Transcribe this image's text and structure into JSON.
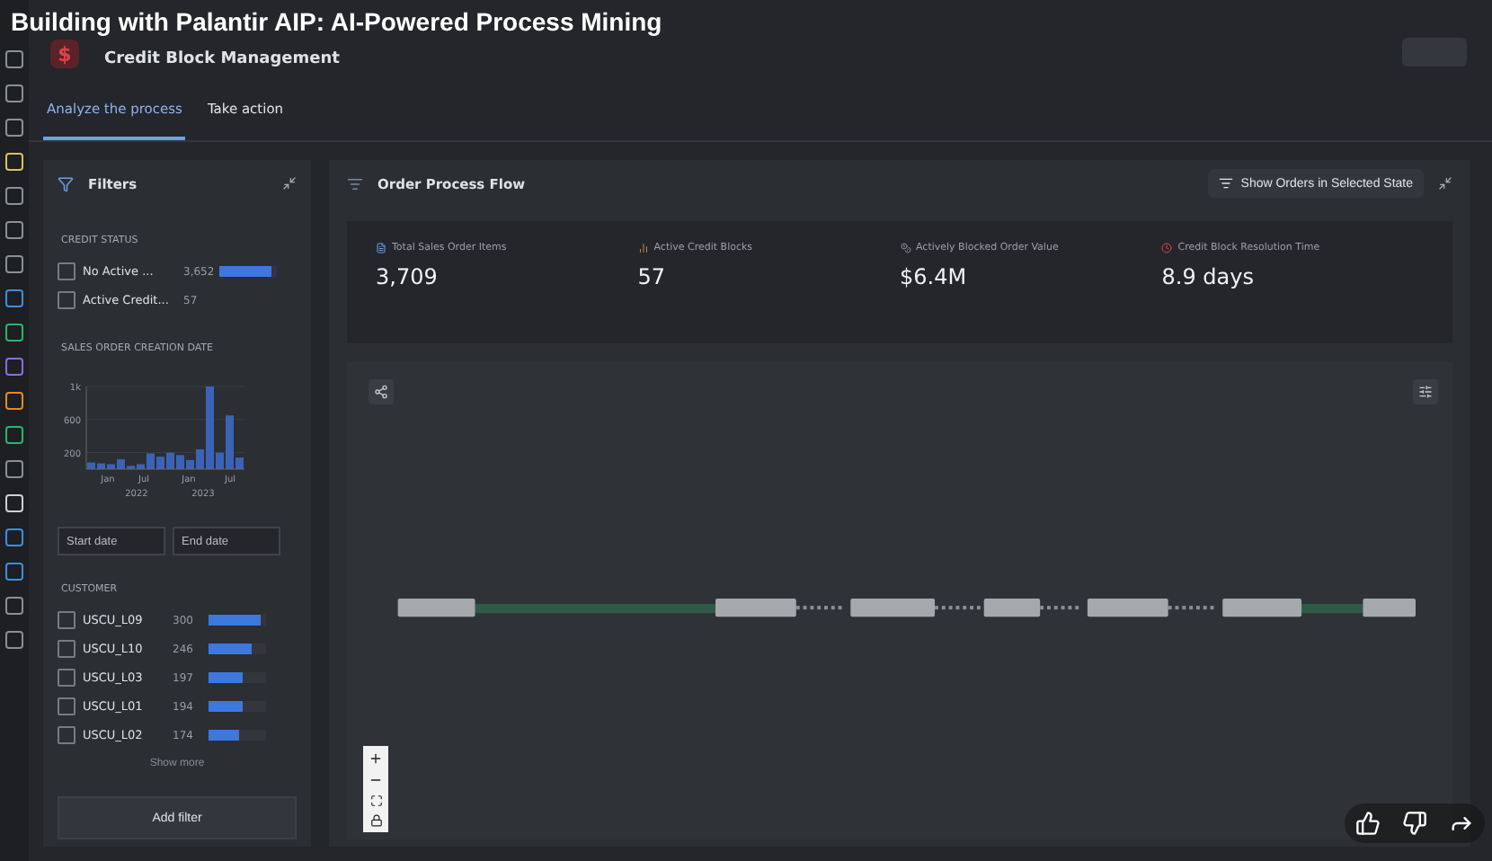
{
  "video_title": "Building with Palantir AIP: AI-Powered Process Mining",
  "rail_icons": [
    {
      "color": "#8a8f98"
    },
    {
      "color": "#8a8f98"
    },
    {
      "color": "#8a8f98"
    },
    {
      "color": "#d9c25a"
    },
    {
      "color": "#8a8f98"
    },
    {
      "color": "#8a8f98"
    },
    {
      "color": "#8a8f98"
    },
    {
      "color": "#3d8ee0"
    },
    {
      "color": "#2fb36a"
    },
    {
      "color": "#8a6ee0"
    },
    {
      "color": "#e08a2f"
    },
    {
      "color": "#2fb36a"
    },
    {
      "color": "#8a8f98"
    },
    {
      "color": "#d0d0d0"
    },
    {
      "color": "#3d8ee0"
    },
    {
      "color": "#3d8ee0"
    },
    {
      "color": "#8a8f98"
    },
    {
      "color": "#8a8f98"
    }
  ],
  "app": {
    "logo": "$",
    "title": "Credit Block Management"
  },
  "tabs": [
    {
      "label": "Analyze the process",
      "selected": true
    },
    {
      "label": "Take action",
      "selected": false
    }
  ],
  "filters": {
    "title": "Filters",
    "credit_status": {
      "heading": "CREDIT STATUS",
      "items": [
        {
          "label": "No Active ...",
          "count": "3,652",
          "checked": false,
          "level": 0.9
        },
        {
          "label": "Active Credit...",
          "count": "57",
          "checked": false
        }
      ]
    },
    "creation_date": {
      "heading": "SALES ORDER CREATION DATE",
      "chart_data": {
        "type": "bar",
        "values": [
          80,
          70,
          60,
          120,
          40,
          60,
          190,
          150,
          200,
          170,
          110,
          240,
          1000,
          200,
          650,
          140
        ],
        "ylim": [
          0,
          1000
        ],
        "grid": true,
        "yticks": [
          {
            "value": 200,
            "label": "200"
          },
          {
            "value": 600,
            "label": "600"
          },
          {
            "value": 1000,
            "label": "1k"
          }
        ]
      },
      "months": [
        "Jan",
        "Jul",
        "Jan",
        "Jul"
      ],
      "years": [
        "2022",
        "2023"
      ],
      "start_placeholder": "Start date",
      "end_placeholder": "End date"
    },
    "customer": {
      "heading": "CUSTOMER",
      "items": [
        {
          "label": "USCU_L09",
          "count": "300",
          "checked": false,
          "level": 0.9
        },
        {
          "label": "USCU_L10",
          "count": "246",
          "checked": false,
          "level": 0.74
        },
        {
          "label": "USCU_L03",
          "count": "197",
          "checked": false,
          "level": 0.6
        },
        {
          "label": "USCU_L01",
          "count": "194",
          "checked": false,
          "level": 0.58
        },
        {
          "label": "USCU_L02",
          "count": "174",
          "checked": false,
          "level": 0.52
        }
      ],
      "more": "Show more"
    },
    "add": "Add filter"
  },
  "flow": {
    "title": "Order Process Flow",
    "action": "Show Orders in Selected State",
    "kpis": [
      {
        "kind": "doc",
        "label": "Total Sales Order Items",
        "value": "3,709"
      },
      {
        "kind": "bar",
        "label": "Active Credit Blocks",
        "value": "57"
      },
      {
        "kind": "coin",
        "label": "Actively Blocked Order Value",
        "value": "$6.4M"
      },
      {
        "kind": "clock",
        "label": "Credit Block Resolution Time",
        "value": "8.9 days"
      }
    ],
    "edges": [
      {
        "highlighted": true
      },
      {
        "highlighted": false
      },
      {
        "highlighted": false
      },
      {
        "highlighted": false
      },
      {
        "highlighted": false
      },
      {
        "highlighted": true
      }
    ]
  }
}
